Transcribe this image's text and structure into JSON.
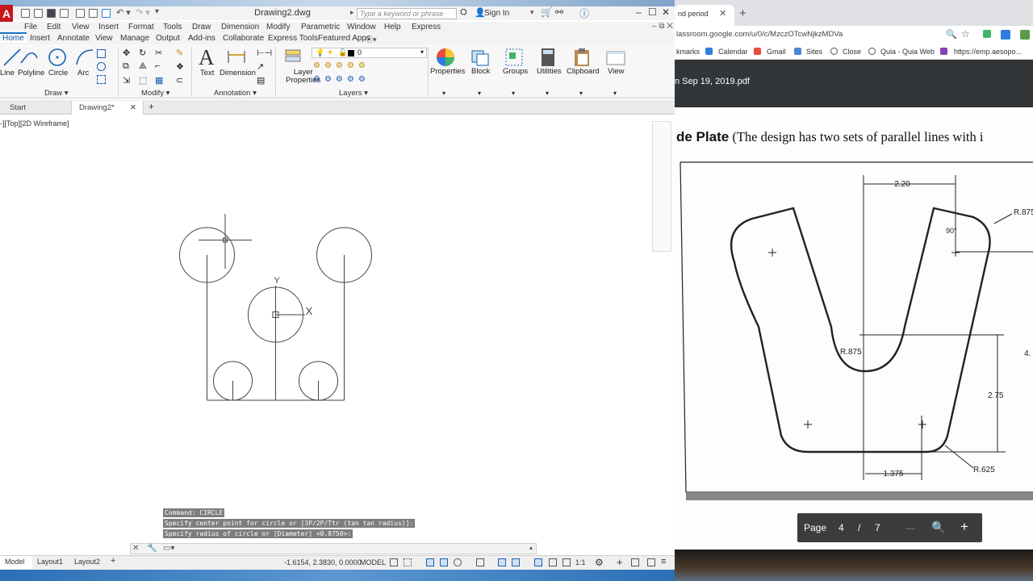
{
  "acad": {
    "file_title": "Drawing2.dwg",
    "search_placeholder": "Type a keyword or phrase",
    "sign_in": "Sign In",
    "menus": [
      "File",
      "Edit",
      "View",
      "Insert",
      "Format",
      "Tools",
      "Draw",
      "Dimension",
      "Modify",
      "Parametric",
      "Window",
      "Help",
      "Express"
    ],
    "ribbon_tabs": [
      "Home",
      "Insert",
      "Annotate",
      "View",
      "Manage",
      "Output",
      "Add-ins",
      "Collaborate",
      "Express Tools",
      "Featured Apps"
    ],
    "draw_tools": [
      "Line",
      "Polyline",
      "Circle",
      "Arc"
    ],
    "text_tool": "Text",
    "dimension_tool": "Dimension",
    "layer_props": [
      "Layer",
      "Properties"
    ],
    "layer_value": "0",
    "big_tools": [
      "Properties",
      "Block",
      "Groups",
      "Utilities",
      "Clipboard",
      "View"
    ],
    "panels": [
      "Draw",
      "Modify",
      "Annotation",
      "Layers"
    ],
    "doc_tabs": [
      "Start",
      "Drawing2*"
    ],
    "viewport_label": "-][Top][2D Wireframe]",
    "ucs_y": "Y",
    "ucs_x": "X",
    "command_history": [
      "Command: CIRCLE",
      "Specify center point for circle or [3P/2P/Ttr (tan tan radius)]:",
      "Specify radius of circle or [Diameter] <0.8750>:"
    ],
    "layout_tabs": [
      "Model",
      "Layout1",
      "Layout2"
    ],
    "coords": "-1.6154, 2.3830, 0.0000",
    "model_label": "MODEL",
    "scale": "1:1"
  },
  "browser": {
    "tab_title": "nd period",
    "url": "lassroom.google.com/u/0/c/MzczOTcwNjkzMDVa",
    "bookmarks": [
      "kmarks",
      "Calendar",
      "Gmail",
      "Sites",
      "Close",
      "Quia - Quia Web",
      "https://emp.aesopo..."
    ],
    "pdf_filename": "n Sep 19, 2019.pdf",
    "heading_bold": "de Plate",
    "heading_rest": " (The design has two sets of parallel lines with i",
    "dims": {
      "top_width": "2.20",
      "radius_top_right": "R.875",
      "angle": "90°",
      "radius_bottom_inner": "R.875",
      "height_right": "2.75",
      "right_partial": "4.",
      "bottom_width": "1.375",
      "radius_bottom": "R.625"
    },
    "pdf_page_label": "Page",
    "pdf_page_current": "4",
    "pdf_page_sep": "/",
    "pdf_page_total": "7"
  },
  "colors": {
    "autocad_red": "#c4161c",
    "ribbon_accent": "#1a73c7",
    "pdf_dark": "#323639"
  }
}
